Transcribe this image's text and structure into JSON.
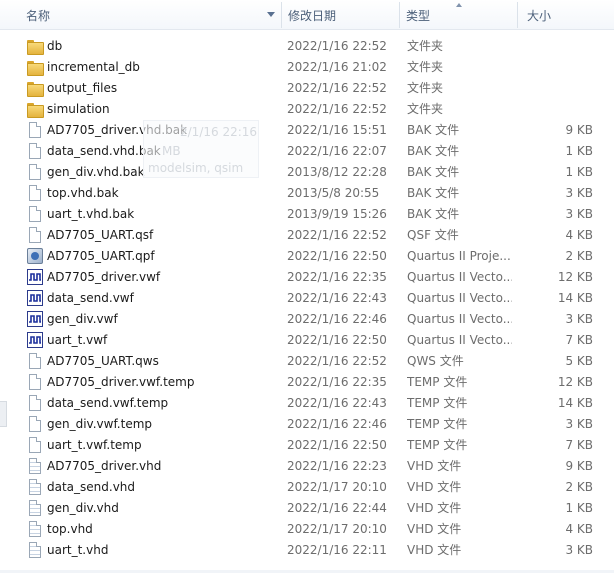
{
  "columns": {
    "name": "名称",
    "date": "修改日期",
    "type": "类型",
    "size": "大小"
  },
  "ghost_tooltip": {
    "line1": "2/1/16 22:16",
    "line2": "MB",
    "line3": "modelsim, qsim"
  },
  "files": [
    {
      "name": "db",
      "date": "2022/1/16 22:52",
      "type": "文件夹",
      "size": "",
      "icon": "folder-icon"
    },
    {
      "name": "incremental_db",
      "date": "2022/1/16 21:02",
      "type": "文件夹",
      "size": "",
      "icon": "folder-icon"
    },
    {
      "name": "output_files",
      "date": "2022/1/16 22:52",
      "type": "文件夹",
      "size": "",
      "icon": "folder-icon"
    },
    {
      "name": "simulation",
      "date": "2022/1/16 22:52",
      "type": "文件夹",
      "size": "",
      "icon": "folder-icon"
    },
    {
      "name": "AD7705_driver.vhd.bak",
      "date": "2022/1/16 15:51",
      "type": "BAK 文件",
      "size": "9 KB",
      "icon": "document-icon"
    },
    {
      "name": "data_send.vhd.bak",
      "date": "2022/1/16 22:07",
      "type": "BAK 文件",
      "size": "1 KB",
      "icon": "document-icon"
    },
    {
      "name": "gen_div.vhd.bak",
      "date": "2013/8/12 22:28",
      "type": "BAK 文件",
      "size": "1 KB",
      "icon": "document-icon"
    },
    {
      "name": "top.vhd.bak",
      "date": "2013/5/8 20:55",
      "type": "BAK 文件",
      "size": "3 KB",
      "icon": "document-icon"
    },
    {
      "name": "uart_t.vhd.bak",
      "date": "2013/9/19 15:26",
      "type": "BAK 文件",
      "size": "3 KB",
      "icon": "document-icon"
    },
    {
      "name": "AD7705_UART.qsf",
      "date": "2022/1/16 22:52",
      "type": "QSF 文件",
      "size": "4 KB",
      "icon": "document-icon"
    },
    {
      "name": "AD7705_UART.qpf",
      "date": "2022/1/16 22:50",
      "type": "Quartus II Proje...",
      "size": "2 KB",
      "icon": "quartus-project-icon"
    },
    {
      "name": "AD7705_driver.vwf",
      "date": "2022/1/16 22:35",
      "type": "Quartus II Vecto...",
      "size": "12 KB",
      "icon": "waveform-icon"
    },
    {
      "name": "data_send.vwf",
      "date": "2022/1/16 22:43",
      "type": "Quartus II Vecto...",
      "size": "14 KB",
      "icon": "waveform-icon"
    },
    {
      "name": "gen_div.vwf",
      "date": "2022/1/16 22:46",
      "type": "Quartus II Vecto...",
      "size": "3 KB",
      "icon": "waveform-icon"
    },
    {
      "name": "uart_t.vwf",
      "date": "2022/1/16 22:50",
      "type": "Quartus II Vecto...",
      "size": "7 KB",
      "icon": "waveform-icon"
    },
    {
      "name": "AD7705_UART.qws",
      "date": "2022/1/16 22:52",
      "type": "QWS 文件",
      "size": "5 KB",
      "icon": "document-icon"
    },
    {
      "name": "AD7705_driver.vwf.temp",
      "date": "2022/1/16 22:35",
      "type": "TEMP 文件",
      "size": "12 KB",
      "icon": "document-icon"
    },
    {
      "name": "data_send.vwf.temp",
      "date": "2022/1/16 22:43",
      "type": "TEMP 文件",
      "size": "14 KB",
      "icon": "document-icon"
    },
    {
      "name": "gen_div.vwf.temp",
      "date": "2022/1/16 22:46",
      "type": "TEMP 文件",
      "size": "3 KB",
      "icon": "document-icon"
    },
    {
      "name": "uart_t.vwf.temp",
      "date": "2022/1/16 22:50",
      "type": "TEMP 文件",
      "size": "7 KB",
      "icon": "document-icon"
    },
    {
      "name": "AD7705_driver.vhd",
      "date": "2022/1/16 22:23",
      "type": "VHD 文件",
      "size": "9 KB",
      "icon": "vhd-document-icon"
    },
    {
      "name": "data_send.vhd",
      "date": "2022/1/17 20:10",
      "type": "VHD 文件",
      "size": "2 KB",
      "icon": "vhd-document-icon"
    },
    {
      "name": "gen_div.vhd",
      "date": "2022/1/16 22:44",
      "type": "VHD 文件",
      "size": "1 KB",
      "icon": "vhd-document-icon"
    },
    {
      "name": "top.vhd",
      "date": "2022/1/17 20:10",
      "type": "VHD 文件",
      "size": "4 KB",
      "icon": "vhd-document-icon"
    },
    {
      "name": "uart_t.vhd",
      "date": "2022/1/16 22:11",
      "type": "VHD 文件",
      "size": "3 KB",
      "icon": "vhd-document-icon"
    }
  ]
}
